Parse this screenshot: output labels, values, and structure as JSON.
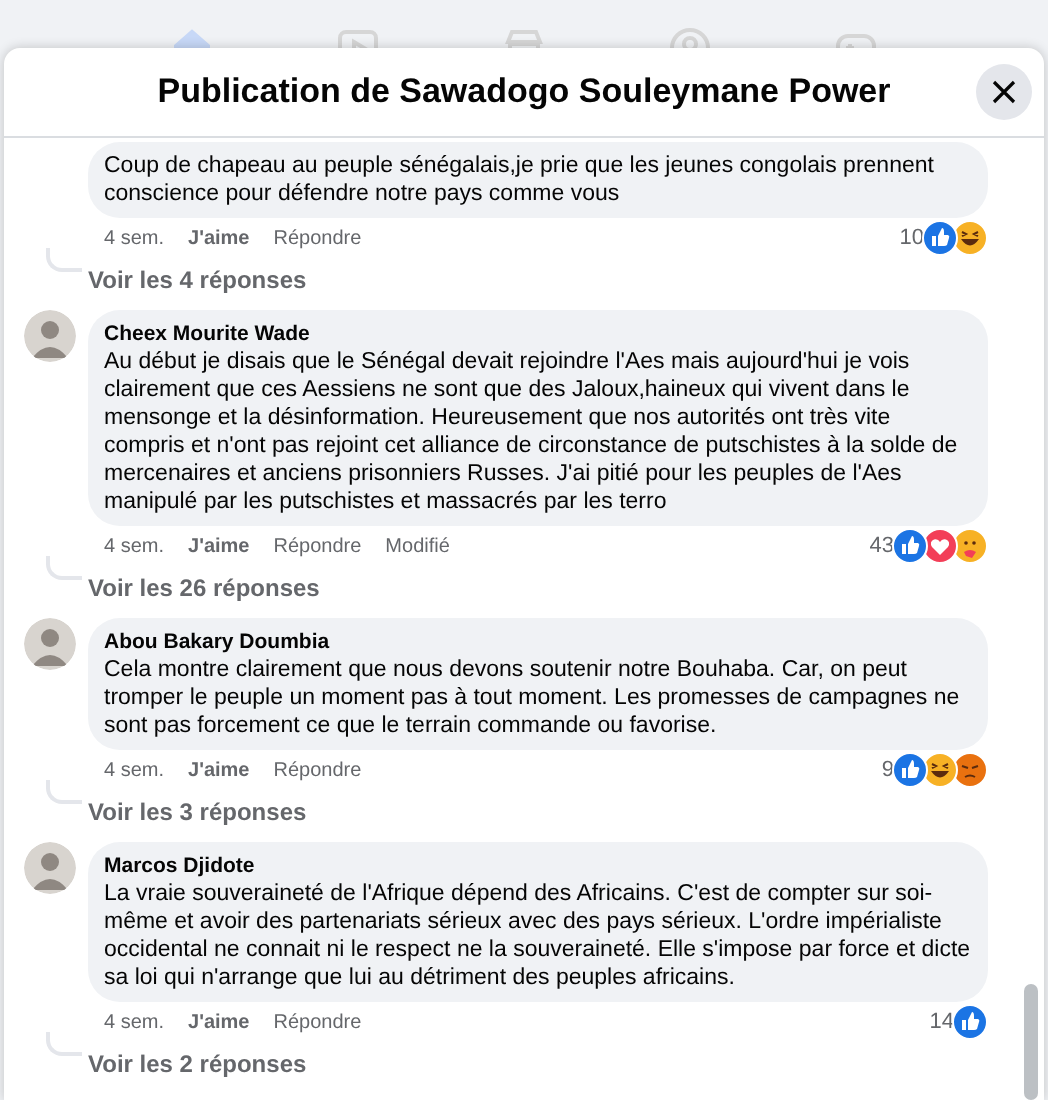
{
  "top_nav": [
    {
      "kind": "home",
      "selected": true
    },
    {
      "kind": "video",
      "selected": false
    },
    {
      "kind": "store",
      "selected": false
    },
    {
      "kind": "groups",
      "selected": false
    },
    {
      "kind": "gaming",
      "selected": false
    }
  ],
  "dialog": {
    "title": "Publication de Sawadogo Souleymane Power"
  },
  "comments": [
    {
      "text": "Coup de chapeau au peuple sénégalais,je prie que les jeunes congolais prennent conscience pour défendre notre pays comme vous",
      "time": "4 sem.",
      "like": "J'aime",
      "reply": "Répondre",
      "reaction_count": "10",
      "reactions": [
        {
          "kind": "like"
        },
        {
          "kind": "haha"
        }
      ],
      "replies": "Voir les 4 réponses"
    },
    {
      "author": "Cheex Mourite Wade",
      "text": "Au début je disais que le Sénégal devait rejoindre l'Aes mais aujourd'hui je vois clairement que ces Aessiens ne sont que des Jaloux,haineux qui vivent dans le mensonge et la désinformation. Heureusement que nos autorités ont très vite compris et n'ont pas rejoint cet alliance de circonstance de putschistes à la solde de mercenaires et anciens prisonniers Russes. J'ai pitié pour les peuples de l'Aes manipulé par les putschistes et massacrés par les terro",
      "time": "4 sem.",
      "like": "J'aime",
      "reply": "Répondre",
      "edited": "Modifié",
      "reaction_count": "43",
      "reactions": [
        {
          "kind": "like"
        },
        {
          "kind": "love"
        },
        {
          "kind": "care"
        }
      ],
      "replies": "Voir les 26 réponses"
    },
    {
      "author": "Abou Bakary Doumbia",
      "text": "Cela montre clairement que nous devons soutenir notre Bouhaba. Car, on peut tromper le peuple un moment pas à tout moment. Les promesses de campagnes ne sont pas forcement ce que le terrain commande ou favorise.",
      "time": "4 sem.",
      "like": "J'aime",
      "reply": "Répondre",
      "reaction_count": "9",
      "reactions": [
        {
          "kind": "like"
        },
        {
          "kind": "haha"
        },
        {
          "kind": "angry"
        }
      ],
      "replies": "Voir les 3 réponses"
    },
    {
      "author": "Marcos Djidote",
      "text": "La vraie souveraineté de l'Afrique dépend des Africains. C'est de compter sur soi-même et avoir des partenariats sérieux avec des pays sérieux. L'ordre impérialiste occidental ne connait ni le respect ne la souveraineté. Elle s'impose par force et dicte sa loi qui n'arrange que lui au détriment des peuples africains.",
      "time": "4 sem.",
      "like": "J'aime",
      "reply": "Répondre",
      "reaction_count": "14",
      "reactions": [
        {
          "kind": "like"
        }
      ],
      "replies": "Voir les 2 réponses"
    }
  ]
}
